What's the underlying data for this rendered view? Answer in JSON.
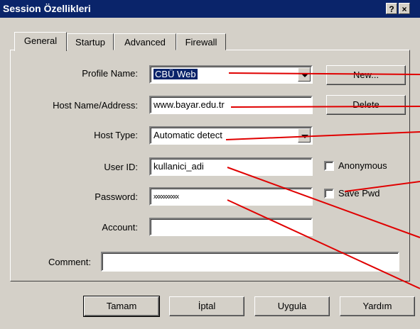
{
  "window": {
    "title": "Session Özellikleri",
    "help_btn": "?",
    "close_btn": "×"
  },
  "tabs": [
    "General",
    "Startup",
    "Advanced",
    "Firewall"
  ],
  "active_tab": "General",
  "form": {
    "profile_name": {
      "label": "Profile Name:",
      "value": "CBÜ Web"
    },
    "host_name": {
      "label": "Host Name/Address:",
      "value": "www.bayar.edu.tr"
    },
    "host_type": {
      "label": "Host Type:",
      "value": "Automatic detect"
    },
    "user_id": {
      "label": "User ID:",
      "value": "kullanici_adi"
    },
    "password": {
      "label": "Password:",
      "value": "xxxxxxxxxx"
    },
    "account": {
      "label": "Account:",
      "value": ""
    },
    "comment": {
      "label": "Comment:",
      "value": ""
    }
  },
  "side_buttons": {
    "new": "New...",
    "delete": "Delete"
  },
  "checkboxes": {
    "anonymous": "Anonymous",
    "save_pwd": "Save Pwd"
  },
  "footer_buttons": {
    "ok": "Tamam",
    "cancel": "İptal",
    "apply": "Uygula",
    "help": "Yardım"
  },
  "colors": {
    "face": "#d4d0c8",
    "titlebar": "#0a246a",
    "annotation": "#e00000"
  }
}
